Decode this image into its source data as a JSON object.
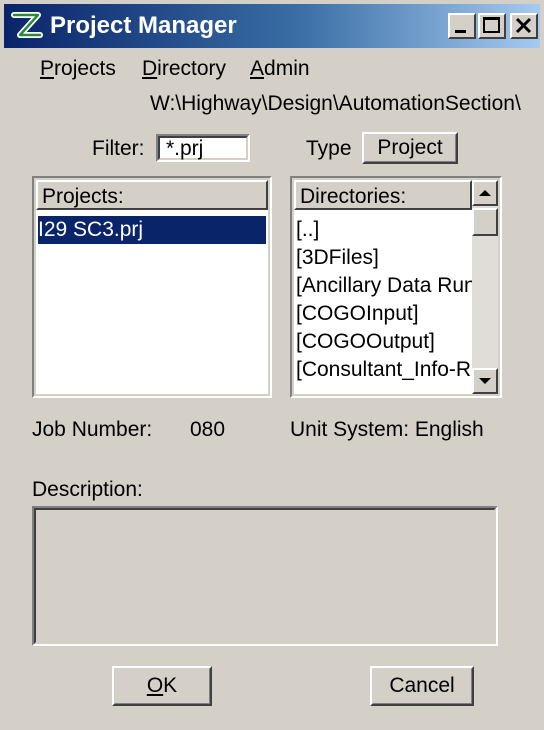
{
  "window": {
    "title": "Project Manager"
  },
  "menu": [
    {
      "label": "Projects",
      "mnemonic": "P"
    },
    {
      "label": "Directory",
      "mnemonic": "D"
    },
    {
      "label": "Admin",
      "mnemonic": "A"
    }
  ],
  "path": "W:\\Highway\\Design\\AutomationSection\\",
  "filter": {
    "label": "Filter:",
    "value": "*.prj"
  },
  "type": {
    "label": "Type",
    "button": "Project"
  },
  "projects": {
    "header": "Projects:",
    "items": [
      "I29 SC3.prj"
    ],
    "selected_index": 0
  },
  "directories": {
    "header": "Directories:",
    "items": [
      "[..]",
      "[3DFiles]",
      "[Ancillary Data Runs]",
      "[COGOInput]",
      "[COGOOutput]",
      "[Consultant_Info-Rec"
    ]
  },
  "job": {
    "label": "Job Number:",
    "value": "080"
  },
  "unit_system": {
    "label": "Unit System: English"
  },
  "description": {
    "label": "Description:",
    "value": ""
  },
  "buttons": {
    "ok": "OK",
    "ok_mnemonic": "O",
    "cancel": "Cancel"
  }
}
